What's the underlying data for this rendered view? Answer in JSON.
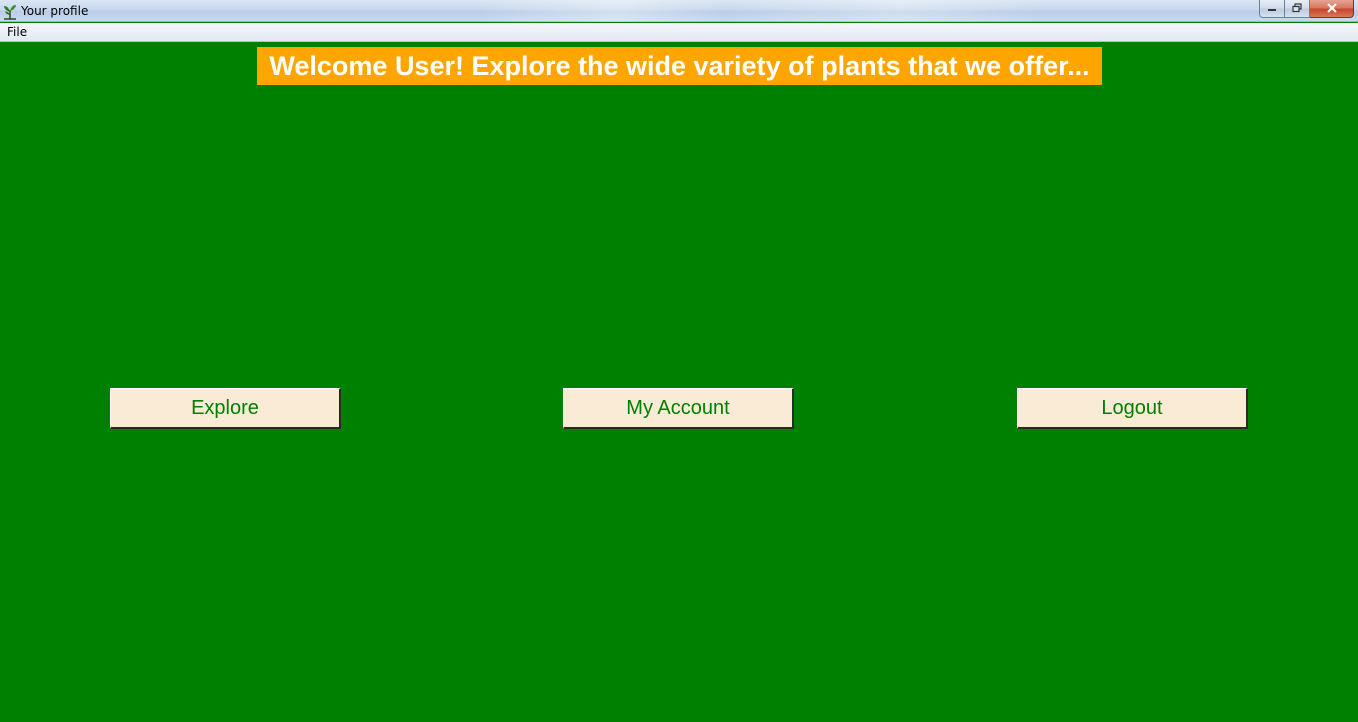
{
  "window": {
    "title": "Your profile",
    "app_icon": "plant-icon",
    "controls": [
      "minimize-icon",
      "restore-icon",
      "close-icon"
    ]
  },
  "menubar": {
    "items": [
      {
        "label": "File"
      }
    ]
  },
  "main": {
    "welcome_text": "Welcome User! Explore the wide variety of plants that we offer...",
    "buttons": [
      {
        "label": "Explore"
      },
      {
        "label": "My Account"
      },
      {
        "label": "Logout"
      }
    ]
  },
  "colors": {
    "background": "#008000",
    "banner_bg": "#ffa500",
    "banner_text": "#ffffff",
    "button_bg": "#faebd7",
    "button_text": "#008000"
  }
}
